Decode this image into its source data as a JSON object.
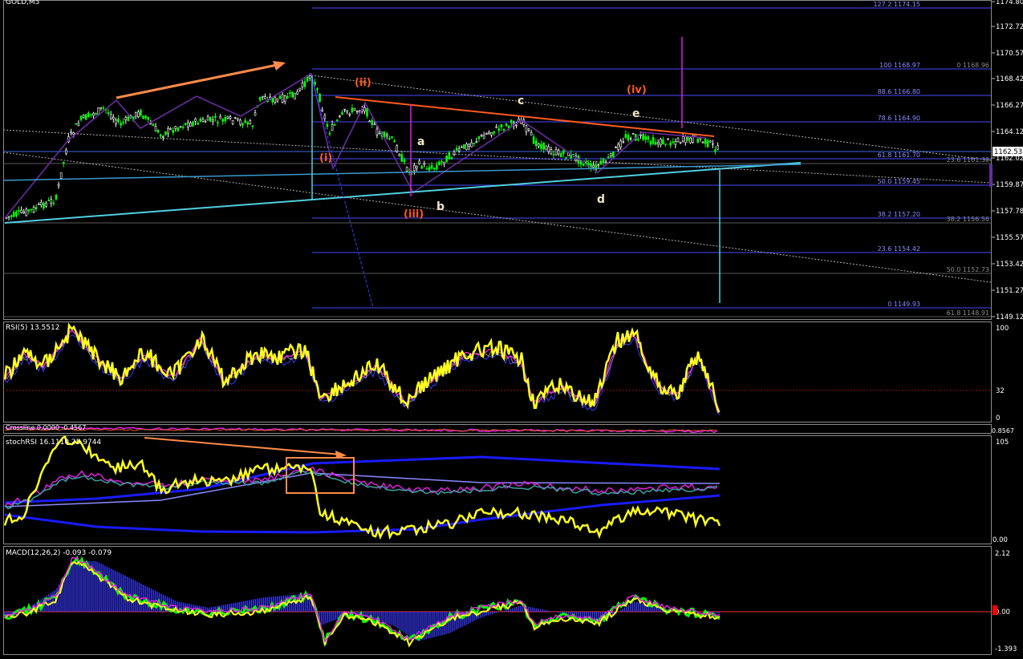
{
  "window": {
    "symbol_title": "GOLD,M5"
  },
  "colors": {
    "background": "#000000",
    "grid": "#6a6a6a",
    "bull_candle": "#00ff00",
    "bear_candle": "#ffffff",
    "fib_line": "#4a4aff",
    "fib_text": "#8a8aff",
    "trend_orange": "#ff5a1e",
    "arrow_orange": "#ff8a4a",
    "channel_cyan": "#4fd0e0",
    "wave_purple": "#6a2aa0",
    "rsi_yellow": "#ffff20",
    "magenta": "#e020e0",
    "blue_line": "#0000ff",
    "price_badge_bg": "#ffffff"
  },
  "price_axis": {
    "ticks": [
      "1174.80",
      "1172.72",
      "1170.57",
      "1168.42",
      "1166.27",
      "1164.12",
      "1162.02",
      "1159.87",
      "1157.78",
      "1155.57",
      "1153.42",
      "1151.27",
      "1149.12"
    ],
    "current_price": "1162.53"
  },
  "fib_levels_left": [
    {
      "label": "127.2",
      "price": "1174.15"
    },
    {
      "label": "100",
      "price": "1168.97"
    },
    {
      "label": "88.6",
      "price": "1166.80"
    },
    {
      "label": "78.6",
      "price": "1164.90"
    },
    {
      "label": "61.8",
      "price": "1161.70"
    },
    {
      "label": "50.0",
      "price": "1159.45"
    },
    {
      "label": "38.2",
      "price": "1157.20"
    },
    {
      "label": "23.6",
      "price": "1154.42"
    },
    {
      "label": "0",
      "price": "1149.93"
    }
  ],
  "fib_levels_right": [
    {
      "label": "0",
      "price": "1168.96"
    },
    {
      "label": "23.6",
      "price": "1161.30"
    },
    {
      "label": "38.2",
      "price": "1156.56"
    },
    {
      "label": "50.0",
      "price": "1152.73"
    },
    {
      "label": "61.8",
      "price": "1148.91"
    }
  ],
  "wave_labels": {
    "i": "(i)",
    "ii": "(ii)",
    "iii": "(iii)",
    "iv": "(iv)",
    "a": "a",
    "b": "b",
    "c": "c",
    "d": "d",
    "e": "e"
  },
  "rsi": {
    "title": "RSI(5) 13.5512",
    "axis": [
      "100",
      "32",
      "0"
    ]
  },
  "thin_pane": {
    "title": "Crossline 0.0000 -0.4567",
    "axis": "0.8567"
  },
  "stoch": {
    "title": "stochRSI 16.1110 25.9744",
    "axis": [
      "105",
      "0.00"
    ]
  },
  "macd": {
    "title": "MACD(12,26,2) -0.093 -0.079",
    "axis": [
      "2.12",
      "0.00",
      "-1.393"
    ]
  }
}
